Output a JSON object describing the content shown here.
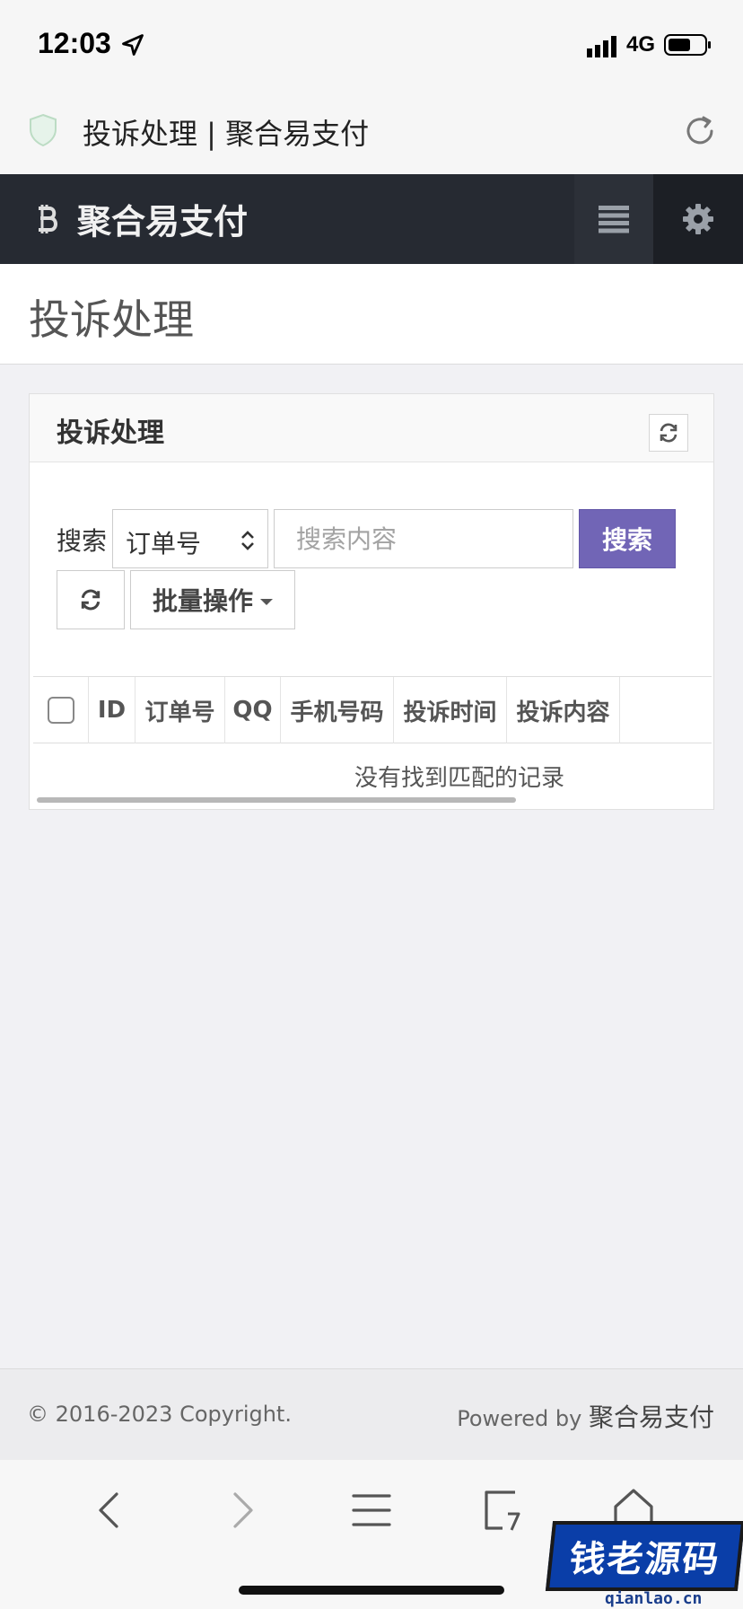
{
  "status_bar": {
    "time": "12:03",
    "network": "4G"
  },
  "browser": {
    "tab_title": "投诉处理 | 聚合易支付"
  },
  "navbar": {
    "brand": "聚合易支付"
  },
  "page": {
    "title": "投诉处理"
  },
  "panel": {
    "title": "投诉处理",
    "search_label": "搜索",
    "search_field_selected": "订单号",
    "search_placeholder": "搜索内容",
    "search_button": "搜索",
    "batch_button": "批量操作"
  },
  "table": {
    "columns": [
      "ID",
      "订单号",
      "QQ",
      "手机号码",
      "投诉时间",
      "投诉内容"
    ],
    "empty_message": "没有找到匹配的记录"
  },
  "footer": {
    "copyright": "© 2016-2023 Copyright.",
    "powered_prefix": "Powered by ",
    "powered_name": "聚合易支付"
  },
  "watermark": {
    "text": "钱老源码",
    "site": "qianlao.cn"
  },
  "colors": {
    "navbar_bg": "#262a32",
    "primary_button": "#7165b6",
    "watermark_blue": "#0a3ea8"
  },
  "icons": {
    "location": "location-arrow-icon",
    "shield": "shield-icon",
    "reload": "reload-icon",
    "brand": "bitcoin-icon",
    "menu": "menu-icon",
    "settings": "gear-icon",
    "refresh": "refresh-icon"
  }
}
